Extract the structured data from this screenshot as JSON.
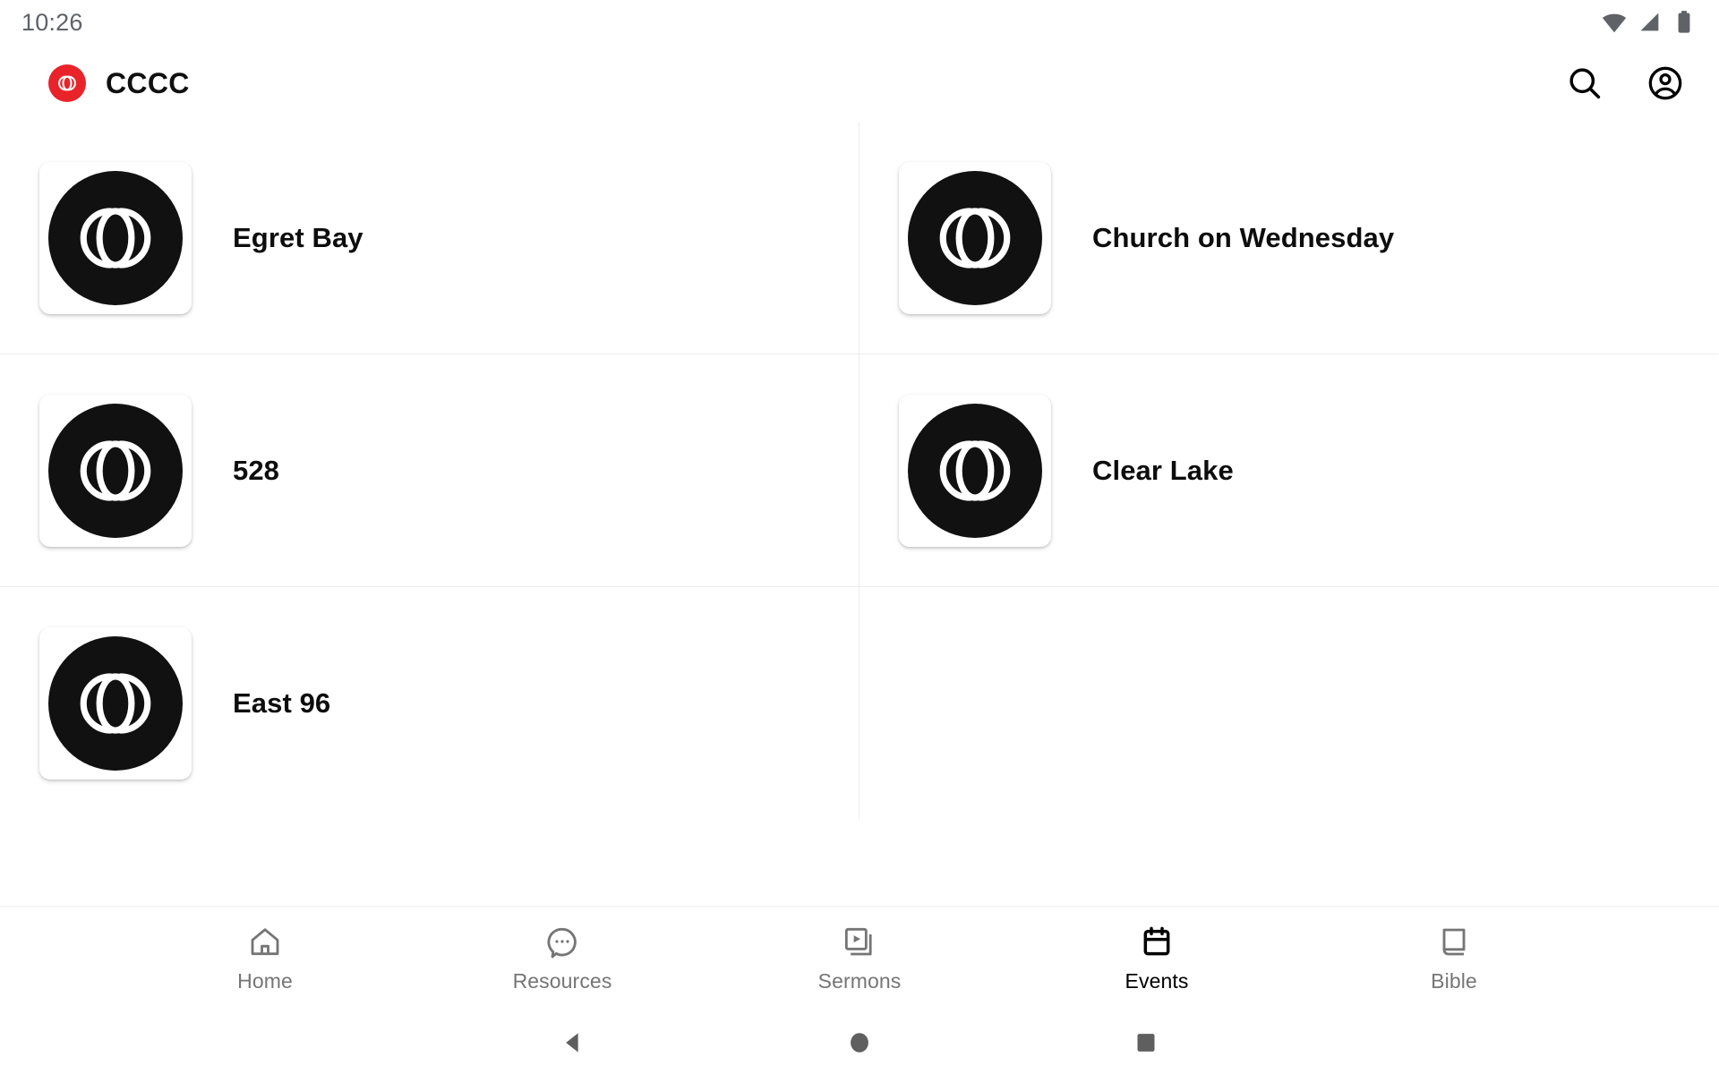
{
  "status_bar": {
    "clock": "10:26",
    "icons": [
      "wifi-icon",
      "cellular-signal-icon",
      "battery-icon"
    ]
  },
  "app_bar": {
    "logo_icon": "cccc-monogram-logo",
    "title": "CCCC",
    "actions": [
      {
        "name": "search-icon",
        "label": "Search"
      },
      {
        "name": "account-circle-icon",
        "label": "Account"
      }
    ]
  },
  "campus_list": {
    "items": [
      {
        "name": "Egret Bay",
        "icon": "cccc-monogram-logo"
      },
      {
        "name": "Church on Wednesday",
        "icon": "cccc-monogram-logo"
      },
      {
        "name": "528",
        "icon": "cccc-monogram-logo"
      },
      {
        "name": "Clear Lake",
        "icon": "cccc-monogram-logo"
      },
      {
        "name": "East 96",
        "icon": "cccc-monogram-logo"
      }
    ]
  },
  "bottom_nav": {
    "active_index": 3,
    "items": [
      {
        "label": "Home",
        "icon": "home-icon"
      },
      {
        "label": "Resources",
        "icon": "chat-bubble-icon"
      },
      {
        "label": "Sermons",
        "icon": "video-library-icon"
      },
      {
        "label": "Events",
        "icon": "calendar-icon"
      },
      {
        "label": "Bible",
        "icon": "book-icon"
      }
    ]
  },
  "system_nav": {
    "buttons": [
      {
        "name": "back-button",
        "icon": "triangle-back-icon"
      },
      {
        "name": "home-button",
        "icon": "circle-home-icon"
      },
      {
        "name": "recents-button",
        "icon": "square-recents-icon"
      }
    ]
  },
  "colors": {
    "brand_red": "#e8242a",
    "tile_black": "#111111",
    "divider": "#ececec",
    "inactive_nav": "#757575",
    "active_nav": "#000000",
    "status_text": "#5f6368"
  }
}
